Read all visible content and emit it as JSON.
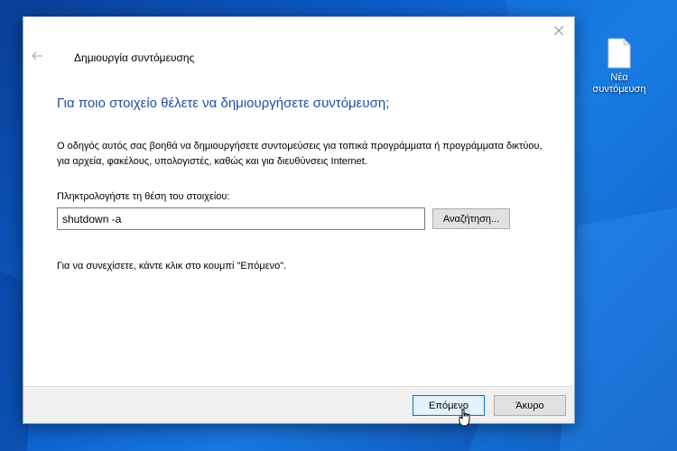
{
  "desktop": {
    "icon": {
      "glyph": "blank-file-icon",
      "label": "Νέα\nσυντόμευση"
    }
  },
  "wizard": {
    "title": "Δημιουργία συντόμευσης",
    "main_instruction": "Για ποιο στοιχείο θέλετε να δημιουργήσετε συντόμευση;",
    "description": "Ο οδηγός αυτός σας βοηθά να δημιουργήσετε συντομεύσεις για τοπικά προγράμματα ή προγράμματα δικτύου, για αρχεία, φακέλους, υπολογιστές, καθώς και για διευθύνσεις Internet.",
    "field_label": "Πληκτρολογήστε τη θέση του στοιχείου:",
    "location_value": "shutdown -a",
    "browse_label": "Αναζήτηση...",
    "continue_hint": "Για να συνεχίσετε, κάντε κλικ στο κουμπί \"Επόμενο\".",
    "next_label": "Επόμενο",
    "cancel_label": "Άκυρο"
  },
  "colors": {
    "accent": "#0078d7",
    "instruction_text": "#1f4e9b",
    "desktop_bg": "#0b5cc9"
  }
}
